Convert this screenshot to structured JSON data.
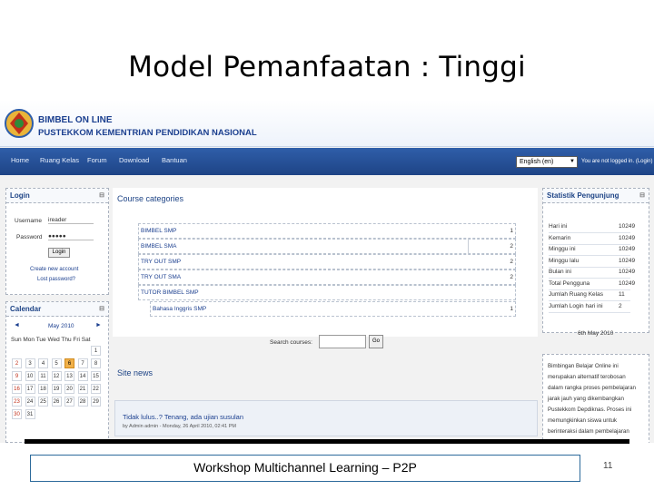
{
  "slide": {
    "title": "Model Pemanfaatan : Tinggi",
    "footer": "Workshop Multichannel Learning – P2P",
    "page_number": "11"
  },
  "site": {
    "brand_line1": "BIMBEL ON LINE",
    "brand_line2": "PUSTEKKOM KEMENTRIAN PENDIDIKAN NASIONAL"
  },
  "nav": {
    "items": [
      {
        "label": "Home"
      },
      {
        "label": "Ruang Kelas"
      },
      {
        "label": "Forum"
      },
      {
        "label": "Download"
      },
      {
        "label": "Bantuan"
      }
    ],
    "language": "English (en)",
    "login_status": "You are not logged in. (Login)"
  },
  "login_block": {
    "title": "Login",
    "username_label": "Username",
    "username_value": "ireader",
    "password_label": "Password",
    "password_value": "●●●●●",
    "login_button": "Login",
    "create_account": "Create new account",
    "lost_password": "Lost password?"
  },
  "calendar": {
    "title": "Calendar",
    "month": "May 2010",
    "prev": "◄",
    "next": "►",
    "weekdays": "Sun Mon Tue Wed Thu Fri Sat",
    "days": [
      "1",
      "2",
      "3",
      "4",
      "5",
      "6",
      "7",
      "8",
      "9",
      "10",
      "11",
      "12",
      "13",
      "14",
      "15",
      "16",
      "17",
      "18",
      "19",
      "20",
      "21",
      "22",
      "23",
      "24",
      "25",
      "26",
      "27",
      "28",
      "29",
      "30",
      "31"
    ],
    "today": "6"
  },
  "courses": {
    "title": "Course categories",
    "categories": [
      {
        "name": "BIMBEL SMP",
        "count": "1"
      },
      {
        "name": "BIMBEL SMA",
        "count": "2"
      },
      {
        "name": "TRY OUT SMP",
        "count": "2"
      },
      {
        "name": "TRY OUT SMA",
        "count": "2"
      },
      {
        "name": "TUTOR BIMBEL SMP",
        "count": ""
      },
      {
        "name": "Bahasa Inggris SMP",
        "count": "1"
      }
    ],
    "search_label": "Search courses:",
    "search_button": "Go"
  },
  "news": {
    "title": "Site news",
    "item_title": "Tidak lulus..? Tenang, ada ujian susulan",
    "item_meta": "by Admin admin - Monday, 26 April 2010, 02:41 PM"
  },
  "stats": {
    "title": "Statistik Pengunjung",
    "rows": [
      {
        "label": "Hari ini",
        "value": "10249"
      },
      {
        "label": "Kemarin",
        "value": "10249"
      },
      {
        "label": "Minggu ini",
        "value": "10249"
      },
      {
        "label": "Minggu lalu",
        "value": "10249"
      },
      {
        "label": "Bulan ini",
        "value": "10249"
      },
      {
        "label": "Total Pengguna",
        "value": "10249"
      },
      {
        "label": "Jumlah Ruang Kelas",
        "value": "11"
      },
      {
        "label": "Jumlah Login hari ini",
        "value": "2"
      }
    ],
    "date": "6th May 2010"
  },
  "about": {
    "lines": [
      "Bimbingan Belajar Online ini",
      "merupakan alternatif terobosan",
      "dalam rangka proses pembelajaran",
      "jarak jauh yang dikembangkan",
      "Pustekkom Depdiknas. Proses ini",
      "memungkinkan siswa untuk",
      "berinteraksi dalam pembelajaran"
    ]
  }
}
